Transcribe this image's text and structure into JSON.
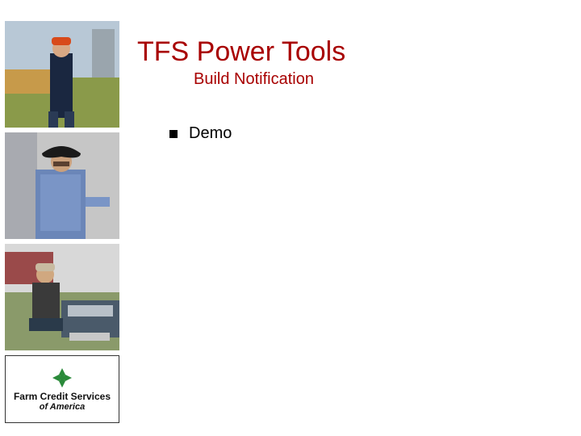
{
  "title": "TFS Power Tools",
  "subtitle": "Build Notification",
  "bullets": [
    "Demo"
  ],
  "logo": {
    "line1": "Farm Credit Services",
    "line2": "of America",
    "mark_color": "#2a8a3a"
  },
  "photos": [
    {
      "name": "photo-farmer-orange-cap"
    },
    {
      "name": "photo-cowboy-denim"
    },
    {
      "name": "photo-farmer-truck"
    }
  ],
  "colors": {
    "heading": "#a80000",
    "text": "#000000"
  }
}
